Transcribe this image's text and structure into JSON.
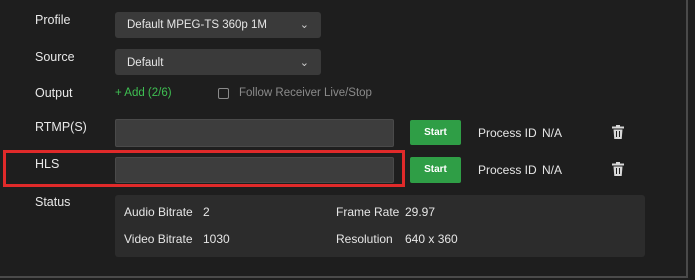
{
  "form": {
    "profile": {
      "label": "Profile",
      "value": "Default MPEG-TS 360p 1M"
    },
    "source": {
      "label": "Source",
      "value": "Default"
    },
    "output": {
      "label": "Output",
      "add_link": "+ Add (2/6)",
      "follow_checkbox_label": "Follow Receiver Live/Stop",
      "follow_checked": false
    }
  },
  "outputs": [
    {
      "label": "RTMP(S)",
      "url_value": "",
      "start_label": "Start",
      "process_id_label": "Process ID",
      "process_id_value": "N/A",
      "delete_icon": "trash-icon"
    },
    {
      "label": "HLS",
      "url_value": "",
      "start_label": "Start",
      "process_id_label": "Process ID",
      "process_id_value": "N/A",
      "delete_icon": "trash-icon",
      "highlighted": true
    }
  ],
  "status": {
    "label": "Status",
    "audio_bitrate_label": "Audio Bitrate",
    "audio_bitrate_value": "2",
    "frame_rate_label": "Frame Rate",
    "frame_rate_value": "29.97",
    "video_bitrate_label": "Video Bitrate",
    "video_bitrate_value": "1030",
    "resolution_label": "Resolution",
    "resolution_value": "640 x 360"
  },
  "colors": {
    "background": "#1e1e1e",
    "field": "#3a3a3a",
    "start_button": "#2f9e46",
    "add_link": "#3fbf52",
    "highlight_box": "#e02a2a"
  }
}
